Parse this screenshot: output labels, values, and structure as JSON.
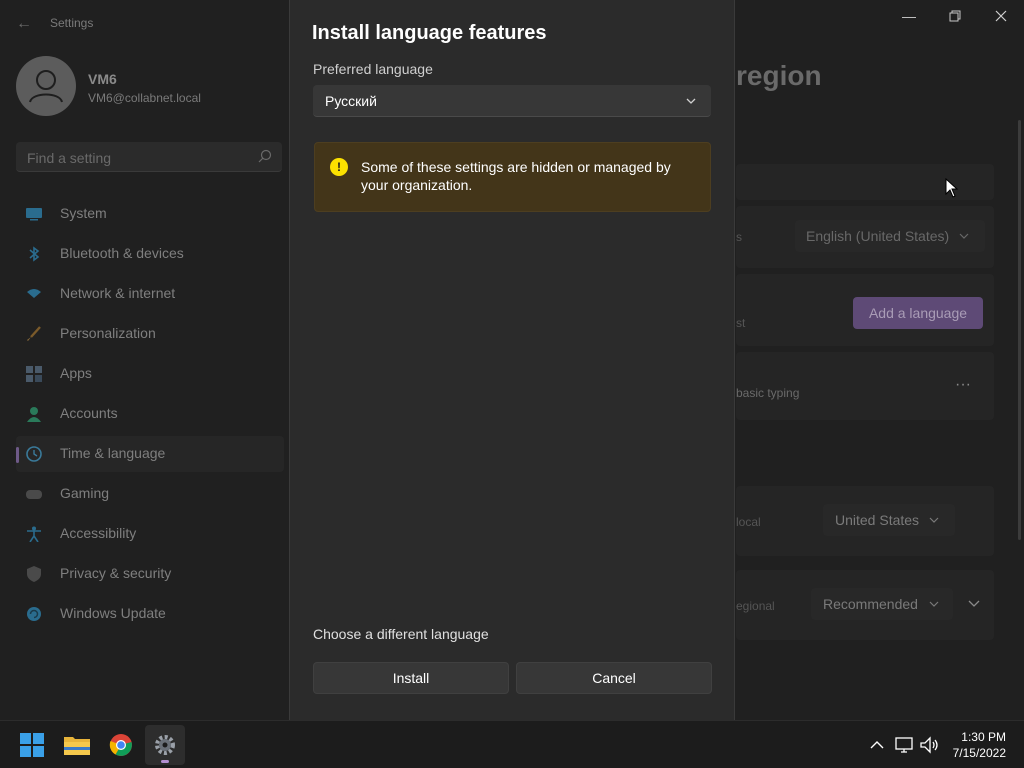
{
  "window": {
    "title": "Settings"
  },
  "user": {
    "name": "VM6",
    "email": "VM6@collabnet.local"
  },
  "search": {
    "placeholder": "Find a setting"
  },
  "nav": {
    "items": [
      {
        "label": "System",
        "icon": "system-icon"
      },
      {
        "label": "Bluetooth & devices",
        "icon": "bluetooth-icon"
      },
      {
        "label": "Network & internet",
        "icon": "network-icon"
      },
      {
        "label": "Personalization",
        "icon": "brush-icon"
      },
      {
        "label": "Apps",
        "icon": "apps-icon"
      },
      {
        "label": "Accounts",
        "icon": "accounts-icon"
      },
      {
        "label": "Time & language",
        "icon": "time-language-icon",
        "selected": true
      },
      {
        "label": "Gaming",
        "icon": "gaming-icon"
      },
      {
        "label": "Accessibility",
        "icon": "accessibility-icon"
      },
      {
        "label": "Privacy & security",
        "icon": "shield-icon"
      },
      {
        "label": "Windows Update",
        "icon": "update-icon"
      }
    ]
  },
  "background_page": {
    "heading_fragment": "region",
    "row1_text": "s",
    "display_language_value": "English (United States)",
    "row2_text": "st",
    "add_language_button": "Add a language",
    "row3_text": "basic typing",
    "row4_text": "local",
    "country_value": "United States",
    "row5_text": "egional",
    "regional_format_value": "Recommended"
  },
  "dialog": {
    "title": "Install language features",
    "preferred_label": "Preferred language",
    "selected_language": "Русский",
    "warning_text": "Some of these settings are hidden or managed by your organization.",
    "choose_link": "Choose a different language",
    "install_button": "Install",
    "cancel_button": "Cancel"
  },
  "taskbar": {
    "apps": [
      "start-icon",
      "file-explorer-icon",
      "chrome-icon",
      "settings-gear-icon"
    ],
    "time": "1:30 PM",
    "date": "7/15/2022"
  },
  "colors": {
    "accent": "#b38fd1",
    "warning_bg": "#433519",
    "warning_icon": "#fce100"
  }
}
